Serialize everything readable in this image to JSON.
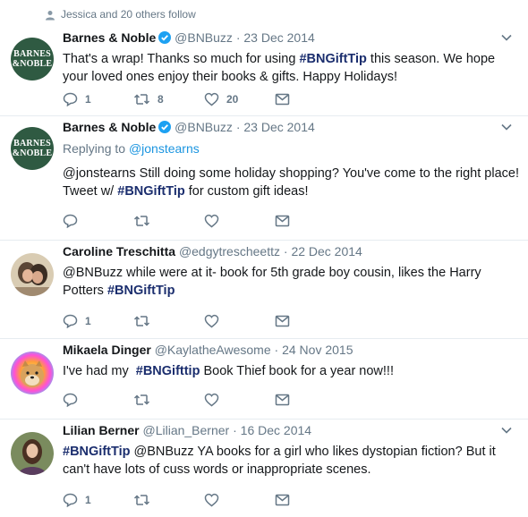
{
  "context": {
    "text": "Jessica and 20 others follow"
  },
  "tweets": [
    {
      "name": "Barnes & Noble",
      "verified": true,
      "handle": "@BNBuzz",
      "date": "23 Dec 2014",
      "avatar_logo": [
        "BARNES",
        "&NOBLE"
      ],
      "text_before": "That's a wrap! Thanks so much for using ",
      "tag": "#BNGiftTip",
      "text_after": " this season. We hope your loved ones enjoy their books & gifts. Happy Holidays!",
      "replies": "1",
      "retweets": "8",
      "likes": "20"
    },
    {
      "name": "Barnes & Noble",
      "verified": true,
      "handle": "@BNBuzz",
      "date": "23 Dec 2014",
      "avatar_logo": [
        "BARNES",
        "&NOBLE"
      ],
      "reply_label": "Replying to ",
      "reply_target": "@jonstearns",
      "text_before": "@jonstearns Still doing some holiday shopping? You've come to the right place! Tweet w/ ",
      "tag": "#BNGiftTip",
      "text_after": " for custom gift ideas!",
      "replies": "",
      "retweets": "",
      "likes": ""
    },
    {
      "name": "Caroline Treschitta",
      "handle": "@edgytrescheettz",
      "date": "22 Dec 2014",
      "text_before": "@BNBuzz while were at it- book for 5th grade boy cousin, likes the Harry Potters ",
      "tag": "#BNGiftTip",
      "text_after": "",
      "replies": "1",
      "retweets": "",
      "likes": ""
    },
    {
      "name": "Mikaela Dinger",
      "handle": "@KaylatheAwesome",
      "date": "24 Nov 2015",
      "text_before": "I've had my  ",
      "tag": "#BNGifttip",
      "text_after": " Book Thief book for a year now!!!",
      "replies": "",
      "retweets": "",
      "likes": ""
    },
    {
      "name": "Lilian Berner",
      "handle": "@Lilian_Berner",
      "date": "16 Dec 2014",
      "text_before": "",
      "tag": "#BNGiftTip",
      "text_after": " @BNBuzz YA books for a girl who likes dystopian fiction? But it can't have lots of cuss words or inappropriate scenes.",
      "replies": "1",
      "retweets": "",
      "likes": ""
    }
  ],
  "dot": "·",
  "colors": {
    "text": "#14171a",
    "muted": "#657786",
    "hashtag": "#1b2e6e",
    "link": "#1b95e0",
    "verified": "#1da1f2",
    "brand": "#2f5a42"
  }
}
